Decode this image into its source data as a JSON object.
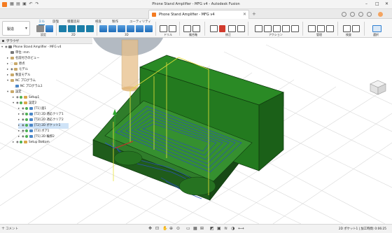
{
  "window": {
    "title": "Phone Stand Amplifier - MFG v4 - Autodesk Fusion"
  },
  "tabs": {
    "active_label": "Phone Stand Amplifier - MFG v4"
  },
  "ribbon": {
    "workspace_label": "製造",
    "tabs": [
      "ミル",
      "旋盤",
      "積層造形",
      "検査",
      "製作",
      "ユーティリティ"
    ],
    "group_labels": [
      "設定",
      "2D",
      "3D",
      "ドリル",
      "複合軸",
      "修正",
      "アクション",
      "管理",
      "検査",
      "選択"
    ]
  },
  "browser": {
    "header": "ブラウザ",
    "items": [
      {
        "label": "Phone Stand Amplifier - MFG v4"
      },
      {
        "label": "単位: mm"
      },
      {
        "label": "名前付きのビュー"
      },
      {
        "label": "原点"
      },
      {
        "label": "モデル"
      },
      {
        "label": "製造モデル"
      },
      {
        "label": "NC プログラム"
      },
      {
        "label": "NC プログラム1"
      },
      {
        "label": "設定"
      },
      {
        "label": "Setup1"
      },
      {
        "label": "設定2"
      },
      {
        "label": "[T1] 面1"
      },
      {
        "label": "[T2] 2D 適応クリア1"
      },
      {
        "label": "[T2] 2D 適応クリア2"
      },
      {
        "label": "[T2] 2D ポケット1"
      },
      {
        "label": "[T3] ボア1"
      },
      {
        "label": "[T5] 2D 輪郭2"
      },
      {
        "label": "Setup Bottom"
      }
    ]
  },
  "bottom": {
    "comment_label": "コメント",
    "status_text": "2D ポケット1 | 加工時間: 0:06:25"
  }
}
